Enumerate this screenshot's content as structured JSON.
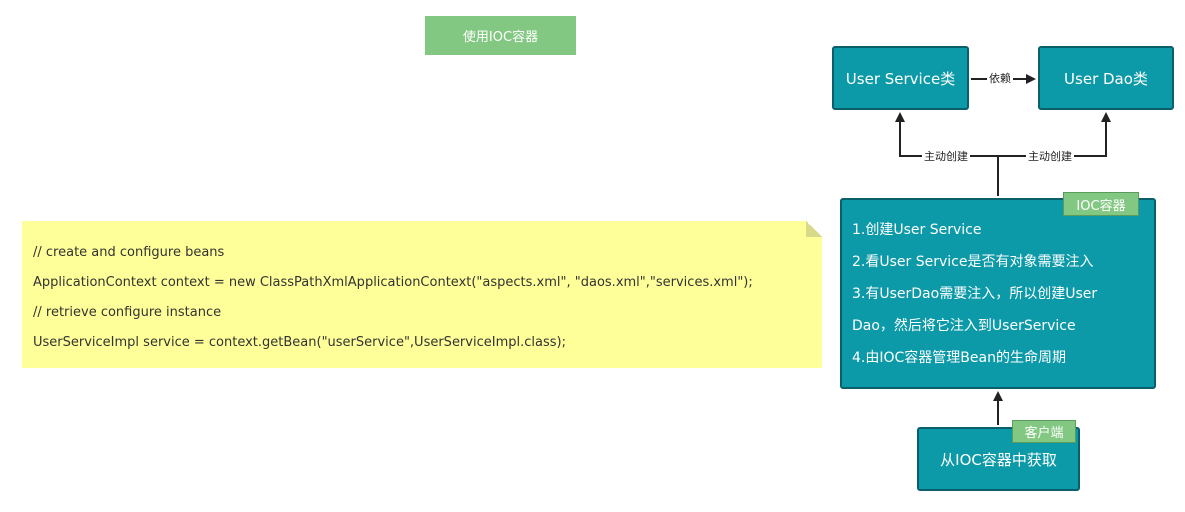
{
  "header": {
    "title": "使用IOC容器"
  },
  "diagram": {
    "user_service": "User Service类",
    "user_dao": "User Dao类",
    "edge_depend": "依赖",
    "edge_create_left": "主动创建",
    "edge_create_right": "主动创建",
    "ioc_tag": "IOC容器",
    "ioc_steps": [
      "1.创建User Service",
      "2.看User Service是否有对象需要注入",
      "3.有UserDao需要注入，所以创建User",
      "Dao，然后将它注入到UserService",
      "4.由IOC容器管理Bean的生命周期"
    ],
    "client_tag": "客户端",
    "client_box": "从IOC容器中获取"
  },
  "note": {
    "lines": [
      "// create and configure beans",
      "ApplicationContext context = new ClassPathXmlApplicationContext(\"aspects.xml\", \"daos.xml\",\"services.xml\");",
      "// retrieve configure instance",
      "UserServiceImpl service = context.getBean(\"userService\",UserServiceImpl.class);"
    ]
  },
  "colors": {
    "box_fill": "#0d9aa8",
    "box_border": "#0a5f6a",
    "tag_green": "#82c882",
    "note_yellow": "#ffff99"
  }
}
